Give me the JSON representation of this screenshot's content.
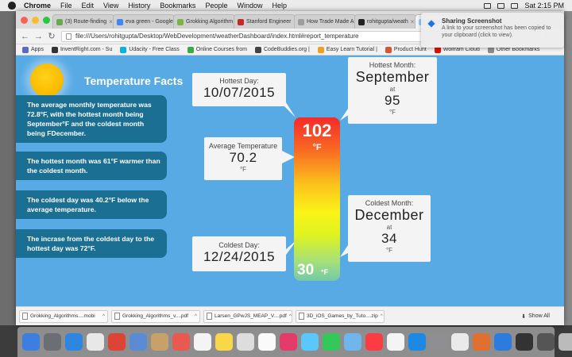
{
  "menubar": {
    "app": "Chrome",
    "items": [
      "File",
      "Edit",
      "View",
      "History",
      "Bookmarks",
      "People",
      "Window",
      "Help"
    ],
    "clock": "Sat 2:15 PM"
  },
  "tabs": [
    {
      "label": "(3) Route-finding",
      "color": "#6aa84f"
    },
    {
      "label": "eva green - Google",
      "color": "#4285f4"
    },
    {
      "label": "Grokking Algorithm",
      "color": "#7cb342"
    },
    {
      "label": "Stanford Engineer",
      "color": "#c62828"
    },
    {
      "label": "How Trade Made A",
      "color": "#9e9e9e"
    },
    {
      "label": "rohitgupta/weath",
      "color": "#222222"
    },
    {
      "label": "Weather Dashboard",
      "color": "#90caf9"
    }
  ],
  "address": "file:///Users/rohitgupta/Desktop/WebDevelopment/weatherDashboard/index.html#report_temperature",
  "bookmarks": [
    {
      "label": "Apps",
      "color": "#5c6bc0"
    },
    {
      "label": "InventRight.com - Su",
      "color": "#333333"
    },
    {
      "label": "Udacity - Free Class",
      "color": "#02b3e4"
    },
    {
      "label": "Online Courses from",
      "color": "#3aa845"
    },
    {
      "label": "CodeBuddies.org |",
      "color": "#444444"
    },
    {
      "label": "Easy Learn Tutorial |",
      "color": "#f0a020"
    },
    {
      "label": "Product Hunt",
      "color": "#da552f"
    },
    {
      "label": "Wolfram Cloud",
      "color": "#dd1100"
    },
    {
      "label": "Other Bookmarks",
      "color": "#8d8d8d"
    }
  ],
  "notification": {
    "title": "Sharing Screenshot",
    "body": "A link to your screenshot has been copied to your clipboard (click to view)."
  },
  "page": {
    "title": "Temperature Facts",
    "facts": [
      "The average monthly temperature was 72.8°F, with the hottest month being September°F and the coldest month being FDecember.",
      "The hottest month was 61°F warmer than the coldest month.",
      "The coldest day was 40.2°F below the average temperature.",
      "The incrase from the coldest day to the hottest day was 72°F."
    ],
    "hottest_day": {
      "label": "Hottest Day:",
      "value": "10/07/2015"
    },
    "average": {
      "label": "Average Temperature",
      "value": "70.2",
      "unit": "°F"
    },
    "coldest_day": {
      "label": "Coldest Day:",
      "value": "12/24/2015"
    },
    "hottest_month": {
      "label": "Hottest Month:",
      "value": "September",
      "at": "at",
      "temp": "95",
      "unit": "°F"
    },
    "coldest_month": {
      "label": "Coldest Month:",
      "value": "December",
      "at": "at",
      "temp": "34",
      "unit": "°F"
    },
    "thermo_top": "102",
    "thermo_top_unit": "°F",
    "thermo_bottom": "30",
    "thermo_bottom_unit": "°F"
  },
  "downloads": [
    "Grokking_Algorithms....mobi",
    "Grokking_Algorithms_v....pdf",
    "Larsen_GPwJS_MEAP_V....pdf",
    "3D_iOS_Games_by_Tuto....zip"
  ],
  "show_all": "Show All",
  "dock_apps": [
    "#3d7ede",
    "#6b6f75",
    "#2f86e0",
    "#e8e8e8",
    "#db4437",
    "#5c8bd6",
    "#c8a06a",
    "#e85a4f",
    "#f4f4f4",
    "#f8d748",
    "#dddddd",
    "#fafafa",
    "#e33b6a",
    "#5ac8fa",
    "#34c759",
    "#6fb6ec",
    "#fc3c44",
    "#f4f4f4",
    "#1e88e5",
    "#8e8e93",
    "#eaeaea",
    "#e07030",
    "#2e7be0",
    "#333333",
    "#555555",
    "#bbbbbb",
    "#cccccc"
  ]
}
